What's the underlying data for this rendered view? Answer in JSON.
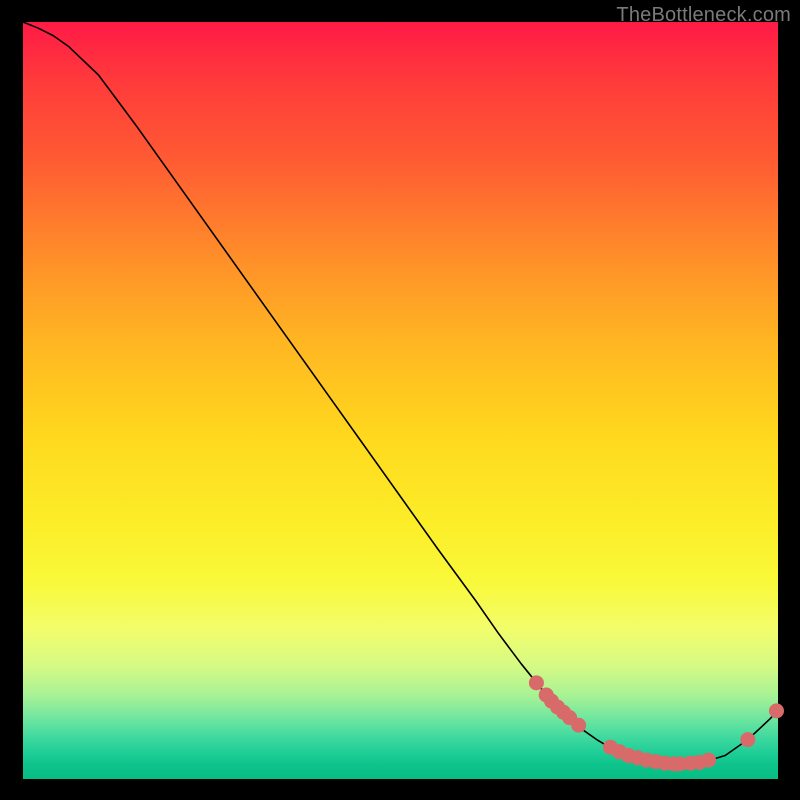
{
  "watermark": "TheBottleneck.com",
  "chart_data": {
    "type": "line",
    "title": "",
    "xlabel": "",
    "ylabel": "",
    "xlim": [
      0,
      100
    ],
    "ylim": [
      0,
      100
    ],
    "grid": false,
    "series": [
      {
        "name": "curve",
        "stroke": "#000000",
        "strokeWidth": 1.6,
        "fill": "none",
        "x": [
          0,
          2,
          4,
          6,
          10,
          15,
          20,
          25,
          30,
          35,
          40,
          45,
          50,
          55,
          60,
          63,
          66,
          69,
          72,
          74,
          76,
          78,
          80,
          82,
          84,
          86,
          88,
          90,
          93,
          96,
          99,
          100
        ],
        "y": [
          100,
          99.2,
          98.2,
          96.8,
          93.0,
          86.3,
          79.3,
          72.3,
          65.3,
          58.3,
          51.3,
          44.3,
          37.3,
          30.3,
          23.5,
          19.2,
          15.2,
          11.5,
          8.4,
          6.6,
          5.2,
          4.0,
          3.2,
          2.6,
          2.2,
          2.0,
          2.0,
          2.2,
          3.1,
          5.2,
          8.0,
          9.2
        ]
      }
    ],
    "marker_clusters": [
      {
        "name": "upper-cluster",
        "color": "#d86a6a",
        "radius": 7.5,
        "points": [
          [
            68.0,
            12.7
          ],
          [
            69.3,
            11.1
          ],
          [
            70.0,
            10.3
          ],
          [
            70.8,
            9.5
          ],
          [
            71.6,
            8.8
          ],
          [
            72.4,
            8.1
          ],
          [
            73.6,
            7.1
          ]
        ]
      },
      {
        "name": "lower-cluster",
        "color": "#d86a6a",
        "radius": 7.5,
        "points": [
          [
            77.8,
            4.2
          ],
          [
            79.0,
            3.6
          ],
          [
            80.2,
            3.1
          ],
          [
            81.4,
            2.8
          ],
          [
            82.6,
            2.5
          ],
          [
            83.8,
            2.3
          ],
          [
            85.0,
            2.1
          ],
          [
            86.2,
            2.0
          ],
          [
            87.0,
            2.0
          ],
          [
            88.4,
            2.1
          ],
          [
            89.6,
            2.2
          ],
          [
            90.8,
            2.5
          ]
        ]
      },
      {
        "name": "tail-cluster",
        "color": "#d86a6a",
        "radius": 7.5,
        "points": [
          [
            96.0,
            5.2
          ],
          [
            99.8,
            9.0
          ]
        ]
      }
    ]
  }
}
